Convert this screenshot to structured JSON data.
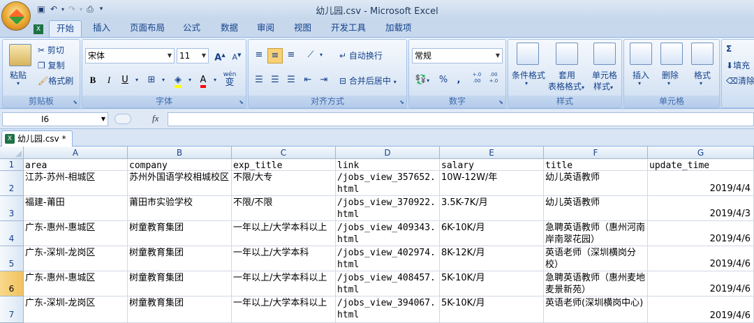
{
  "window": {
    "title": "幼儿园.csv - Microsoft Excel"
  },
  "tabs": [
    "开始",
    "插入",
    "页面布局",
    "公式",
    "数据",
    "审阅",
    "视图",
    "开发工具",
    "加载项"
  ],
  "ribbon": {
    "clipboard": {
      "paste": "粘贴",
      "cut": "剪切",
      "copy": "复制",
      "format_painter": "格式刷",
      "label": "剪贴板"
    },
    "font": {
      "name": "宋体",
      "size": "11",
      "grow": "A",
      "shrink": "A",
      "bold": "B",
      "italic": "I",
      "underline": "U",
      "label": "字体",
      "wen": "wén",
      "wen_char": "变"
    },
    "alignment": {
      "wrap": "自动换行",
      "merge": "合并后居中",
      "label": "对齐方式"
    },
    "number": {
      "format": "常规",
      "percent": "%",
      "comma": ",",
      "inc": "+.0 .00",
      "dec": ".00 +.0",
      "label": "数字"
    },
    "styles": {
      "cond": "条件格式",
      "table": "套用",
      "table2": "表格格式",
      "cell": "单元格",
      "cell2": "样式",
      "label": "样式"
    },
    "cells": {
      "insert": "插入",
      "delete": "删除",
      "format": "格式",
      "label": "单元格"
    },
    "editing": {
      "sum": "Σ",
      "fill": "填充",
      "clear": "清除"
    }
  },
  "formula_bar": {
    "name_box": "I6",
    "fx": "fx",
    "value": ""
  },
  "sheet_tab": {
    "name": "幼儿园.csv *"
  },
  "columns": [
    "A",
    "B",
    "C",
    "D",
    "E",
    "F",
    "G"
  ],
  "rows": [
    {
      "n": "1",
      "cells": [
        "area",
        "company",
        "exp_title",
        "link",
        "salary",
        "title",
        "update_time"
      ]
    },
    {
      "n": "2",
      "cells": [
        "江苏-苏州-相城区",
        "苏州外国语学校相城校区",
        "不限/大专",
        "/jobs_view_357652.html",
        "10W-12W/年",
        "幼儿英语教师",
        "2019/4/4"
      ]
    },
    {
      "n": "3",
      "cells": [
        "福建-莆田",
        "莆田市实验学校",
        "不限/不限",
        "/jobs_view_370922.html",
        "3.5K-7K/月",
        "幼儿英语教师",
        "2019/4/3"
      ]
    },
    {
      "n": "4",
      "cells": [
        "广东-惠州-惠城区",
        "树童教育集团",
        "一年以上/大学本科以上",
        "/jobs_view_409343.html",
        "6K-10K/月",
        "急聘英语教师（惠州河南岸南翠花园）",
        "2019/4/6"
      ]
    },
    {
      "n": "5",
      "cells": [
        "广东-深圳-龙岗区",
        "树童教育集团",
        "一年以上/大学本科",
        "/jobs_view_402974.html",
        "8K-12K/月",
        "英语老师（深圳横岗分校）",
        "2019/4/6"
      ]
    },
    {
      "n": "6",
      "cells": [
        "广东-惠州-惠城区",
        "树童教育集团",
        "一年以上/大学本科以上",
        "/jobs_view_408457.html",
        "5K-10K/月",
        "急聘英语教师（惠州麦地麦景新苑）",
        "2019/4/6"
      ]
    },
    {
      "n": "7",
      "cells": [
        "广东-深圳-龙岗区",
        "树童教育集团",
        "一年以上/大学本科以上",
        "/jobs_view_394067.html",
        "5K-10K/月",
        "英语老师(深圳横岗中心)",
        "2019/4/6"
      ]
    }
  ],
  "selected_row": "6"
}
